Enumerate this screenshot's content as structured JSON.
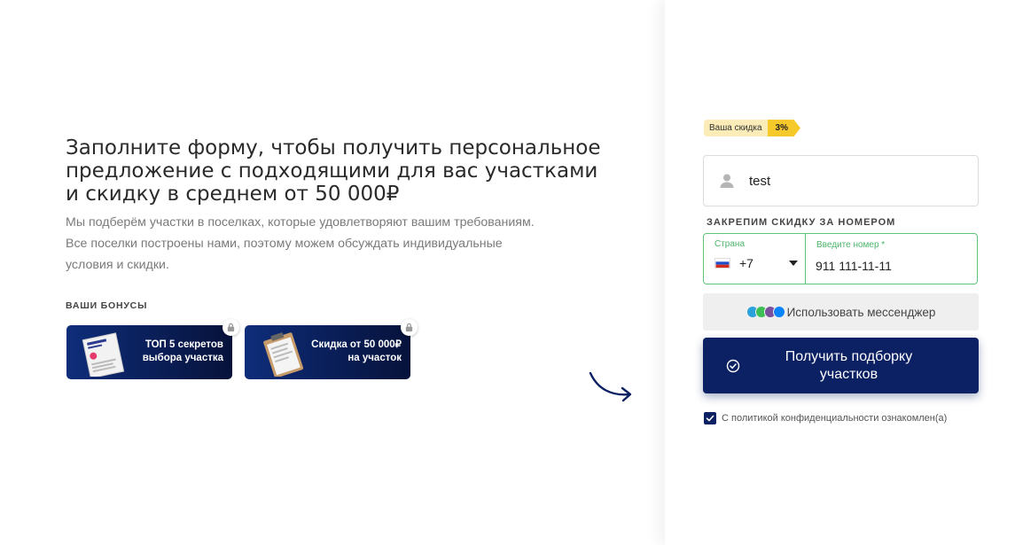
{
  "left": {
    "headline": "Заполните форму, чтобы получить персональное предложение с подходящими для вас участками и скидку в среднем от 50 000₽",
    "description_lines": [
      "Мы подберём участки в поселках, которые удовлетворяют вашим требованиям.",
      "Все поселки построены нами, поэтому можем обсуждать индивидуальные",
      "условия и скидки."
    ],
    "bonuses_title": "ВАШИ БОНУСЫ",
    "bonuses": [
      {
        "label_line1": "ТОП 5 секретов",
        "label_line2": "выбора участка",
        "icon": "book-icon"
      },
      {
        "label_line1": "Скидка от 50 000₽",
        "label_line2": "на участок",
        "icon": "clipboard-icon"
      }
    ]
  },
  "form": {
    "discount_label": "Ваша скидка",
    "discount_value": "3%",
    "name_value": "test",
    "phone_section_title": "ЗАКРЕПИМ СКИДКУ ЗА НОМЕРОМ",
    "country_label": "Страна",
    "country_code": "+7",
    "phone_label": "Введите номер *",
    "phone_value": "911 111-11-11",
    "messenger_button": "Использовать мессенджер",
    "submit_line1": "Получить подборку",
    "submit_line2": "участков",
    "privacy_text": "С политикой конфиденциальности ознакомлен(а)"
  },
  "colors": {
    "primary": "#0c2064",
    "accent_green": "#5cc57a",
    "badge_yellow": "#f6c92b"
  }
}
